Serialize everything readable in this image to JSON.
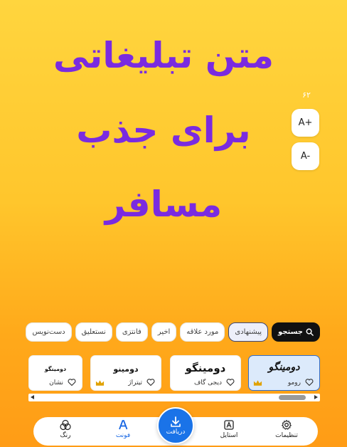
{
  "canvas": {
    "headline_lines": [
      "متن تبلیغاتی",
      "برای جذب",
      "مسافر"
    ],
    "headline_color": "#7A2BE0"
  },
  "size_control": {
    "counter": "۶۲",
    "increase_label": "A+",
    "decrease_label": "A-"
  },
  "filters": {
    "search_label": "جستجو",
    "chips": [
      "پیشنهادی",
      "مورد علاقه",
      "اخیر",
      "فانتزی",
      "نستعلیق",
      "دست‌نویس"
    ],
    "selected": "پیشنهادی"
  },
  "fonts": [
    {
      "sample": "دومینگو",
      "name": "رومو",
      "premium": true,
      "selected": true
    },
    {
      "sample": "دومینگو",
      "name": "دیجی گاف",
      "premium": false,
      "selected": false
    },
    {
      "sample": "دومینو",
      "name": "تیتراژ",
      "premium": true,
      "selected": false
    },
    {
      "sample": "دومینگو",
      "name": "نشان",
      "premium": false,
      "selected": false
    }
  ],
  "scroll": {
    "position": 0.9
  },
  "bottom_nav": {
    "settings": "تنظیمات",
    "style": "استایل",
    "download": "دریافت",
    "font": "فونت",
    "color": "رنگ",
    "active": "فونت"
  },
  "colors": {
    "accent": "#1A73E8",
    "headline": "#7A2BE0",
    "premium_crown": "#E0A100"
  },
  "icons": {
    "search": "search-icon",
    "heart": "heart-icon",
    "crown": "crown-icon",
    "settings": "gear-icon",
    "style": "style-icon",
    "download": "download-icon",
    "font": "font-icon",
    "color": "color-circles-icon"
  }
}
